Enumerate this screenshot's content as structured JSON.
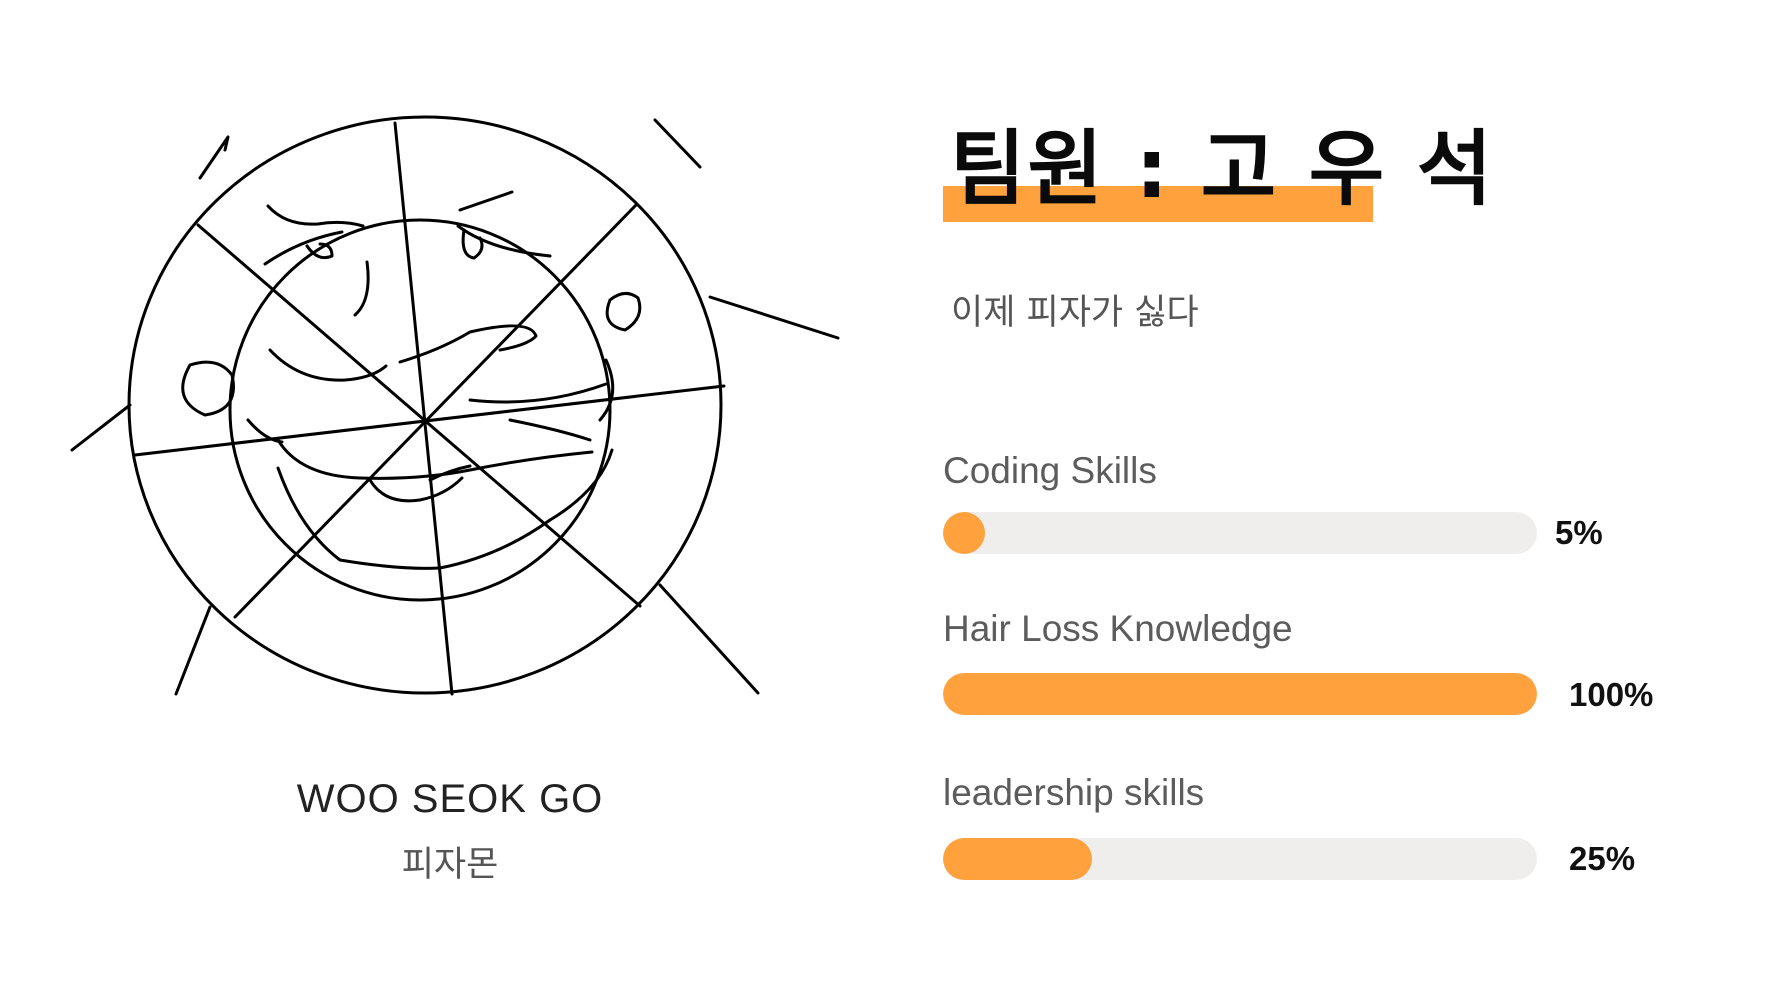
{
  "profile": {
    "title": "팀원 : 고 우 석",
    "subtitle": "이제 피자가 싫다",
    "name": "WOO SEOK GO",
    "nickname": "피자몬"
  },
  "skills": [
    {
      "label": "Coding Skills",
      "value_label": "5%",
      "percent": 5
    },
    {
      "label": "Hair Loss Knowledge",
      "value_label": "100%",
      "percent": 100
    },
    {
      "label": "leadership skills",
      "value_label": "25%",
      "percent": 25
    }
  ],
  "colors": {
    "accent": "#ffa13d",
    "track": "#efeeec",
    "ink": "#111111",
    "muted": "#5c5c5c"
  },
  "icons": {
    "portrait": "pizza-face-sketch-icon"
  }
}
